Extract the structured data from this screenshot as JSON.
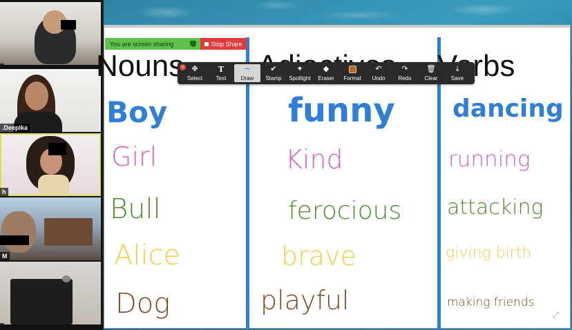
{
  "participants": [
    {
      "name": ""
    },
    {
      "name": ".Deepika"
    },
    {
      "name": "h"
    },
    {
      "name": "M"
    },
    {
      "name": ""
    }
  ],
  "share_banner": {
    "status": "You are screen sharing",
    "stop_label": "Stop Share"
  },
  "toolbar": {
    "tools": [
      {
        "label": "Select",
        "icon": "move-icon",
        "glyph": "✥"
      },
      {
        "label": "Text",
        "icon": "text-icon",
        "glyph": "T"
      },
      {
        "label": "Draw",
        "icon": "draw-icon",
        "glyph": "∼"
      },
      {
        "label": "Stamp",
        "icon": "checkmark-icon",
        "glyph": "✔"
      },
      {
        "label": "Spotlight",
        "icon": "spotlight-wand-icon",
        "glyph": "✦"
      },
      {
        "label": "Eraser",
        "icon": "eraser-icon",
        "glyph": "◆"
      },
      {
        "label": "Format",
        "icon": "color-swatch-icon",
        "glyph": ""
      },
      {
        "label": "Undo",
        "icon": "undo-icon",
        "glyph": "↶"
      },
      {
        "label": "Redo",
        "icon": "redo-icon",
        "glyph": "↷"
      },
      {
        "label": "Clear",
        "icon": "trash-icon",
        "glyph": "🗑"
      },
      {
        "label": "Save",
        "icon": "save-icon",
        "glyph": "⤓"
      }
    ],
    "selected": "Draw",
    "format_color": "#b06a2a"
  },
  "document": {
    "headings": [
      "Nouns",
      "Adjectives",
      "Verbs"
    ],
    "nouns": [
      "Boy",
      "Girl",
      "Bull",
      "Alice",
      "Dog"
    ],
    "adjectives": [
      "funny",
      "Kind",
      "ferocious",
      "brave",
      "playful"
    ],
    "verbs": [
      "dancing",
      "running",
      "attacking",
      "giving birth",
      "making friends"
    ]
  },
  "colors": {
    "column_line": "#2f7fd8",
    "row_colors": [
      "#2f7fd8",
      "#d65fc4",
      "#4f8a33",
      "#f0d045",
      "#7a4a24"
    ]
  }
}
